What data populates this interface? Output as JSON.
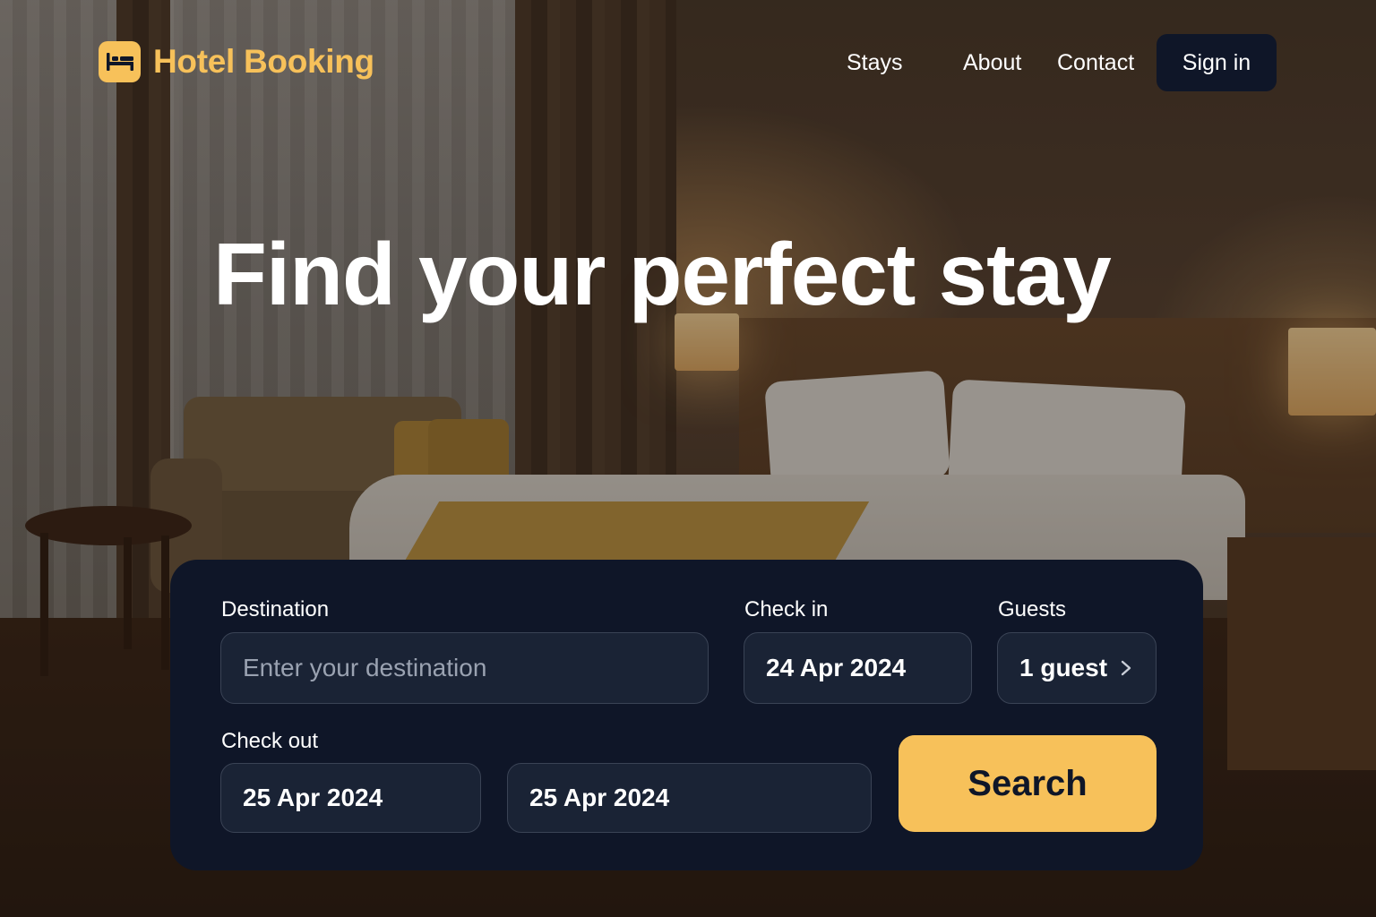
{
  "brand": {
    "name": "Hotel Booking",
    "logo_icon": "bed-icon",
    "accent_color": "#f7c15a"
  },
  "nav": {
    "links": [
      "Stays",
      "About",
      "Contact"
    ],
    "signin_label": "Sign in"
  },
  "hero": {
    "title": "Find your perfect stay"
  },
  "search": {
    "destination_label": "Destination",
    "destination_placeholder": "Enter your destination",
    "checkin_label": "Check in",
    "checkin_value": "24 Apr 2024",
    "guests_label": "Guests",
    "guests_value": "1 guest",
    "checkout_label": "Check out",
    "checkout_value": "25 Apr 2024",
    "extra_date_value": "25 Apr 2024",
    "search_label": "Search",
    "card_color": "#0f1628"
  }
}
